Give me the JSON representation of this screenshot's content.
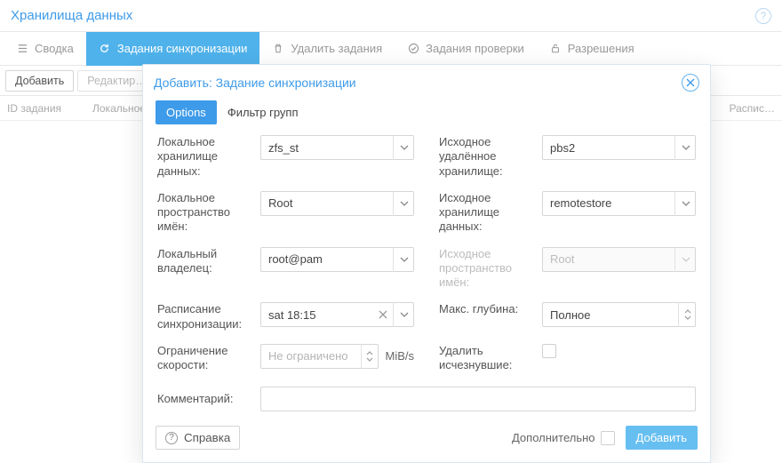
{
  "panel": {
    "title": "Хранилища данных"
  },
  "tabs": {
    "summary": "Сводка",
    "sync": "Задания синхронизации",
    "prune": "Удалить задания",
    "verify": "Задания проверки",
    "perms": "Разрешения"
  },
  "toolbar": {
    "add": "Добавить",
    "edit": "Редактир…"
  },
  "grid": {
    "col_id": "ID задания",
    "col_local": "Локальное",
    "col_sched": "Распис…"
  },
  "modal": {
    "title": "Добавить: Задание синхронизации",
    "tab_options": "Options",
    "tab_groupfilter": "Фильтр групп",
    "labels": {
      "local_store": "Локальное хранилище данных:",
      "local_ns": "Локальное пространство имён:",
      "local_owner": "Локальный владелец:",
      "schedule": "Расписание синхронизации:",
      "rate": "Ограничение скорости:",
      "mib": "MiB/s",
      "remote": "Исходное удалённое хранилище:",
      "remote_store": "Исходное хранилище данных:",
      "remote_ns": "Исходное пространство имён:",
      "max_depth": "Макс. глубина:",
      "remove_vanished": "Удалить исчезнувшие:",
      "comment": "Комментарий:"
    },
    "values": {
      "local_store": "zfs_st",
      "local_ns": "Root",
      "local_owner": "root@pam",
      "schedule": "sat 18:15",
      "rate_ph": "Не ограничено",
      "remote": "pbs2",
      "remote_store": "remotestore",
      "remote_ns": "Root",
      "max_depth": "Полное"
    },
    "bbar": {
      "help": "Справка",
      "advanced": "Дополнительно",
      "submit": "Добавить"
    }
  }
}
